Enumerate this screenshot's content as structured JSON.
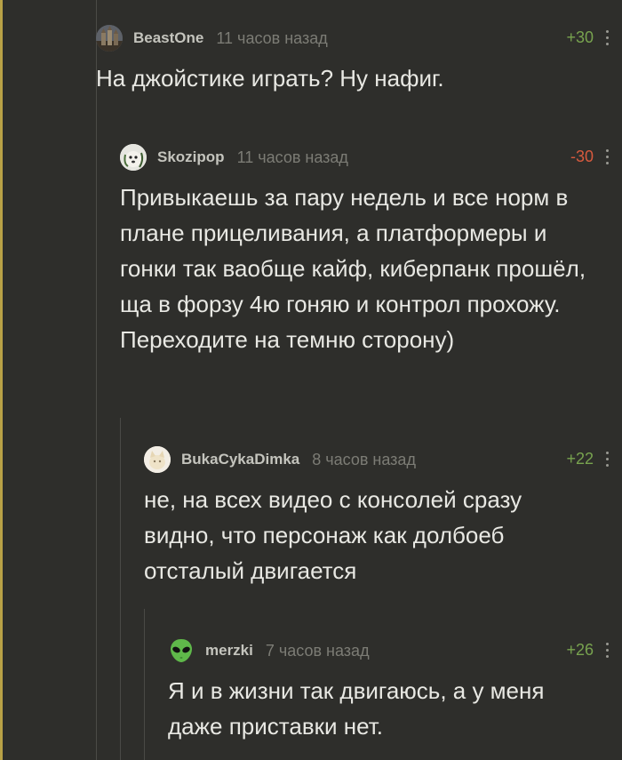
{
  "comments": [
    {
      "username": "BeastOne",
      "time": "11 часов назад",
      "rating": "+30",
      "rating_sign": "positive",
      "avatar_icon": "castle-avatar-icon",
      "text": "На джойстике играть? Ну нафиг."
    },
    {
      "username": "Skozipop",
      "time": "11 часов назад",
      "rating": "-30",
      "rating_sign": "negative",
      "avatar_icon": "dog-avatar-icon",
      "text": "Привыкаешь за пару недель и все норм в плане прицеливания, а платформеры и гонки так ваобще кайф, киберпанк прошёл, ща в форзу 4ю гоняю и контрол прохожу. Переходите на темню сторону)"
    },
    {
      "username": "BukaCykaDimka",
      "time": "8 часов назад",
      "rating": "+22",
      "rating_sign": "positive",
      "avatar_icon": "cat-avatar-icon",
      "text": "не, на всех видео с консолей сразу видно, что персонаж как долбоеб отсталый двигается"
    },
    {
      "username": "merzki",
      "time": "7 часов назад",
      "rating": "+26",
      "rating_sign": "positive",
      "avatar_icon": "alien-avatar-icon",
      "text": "Я и в жизни так двигаюсь, а у меня даже приставки нет."
    }
  ],
  "colors": {
    "background": "#2e2e2b",
    "text": "#e8e8e3",
    "positive": "#78a34f",
    "negative": "#d85a3e",
    "accent": "#b8a146"
  }
}
